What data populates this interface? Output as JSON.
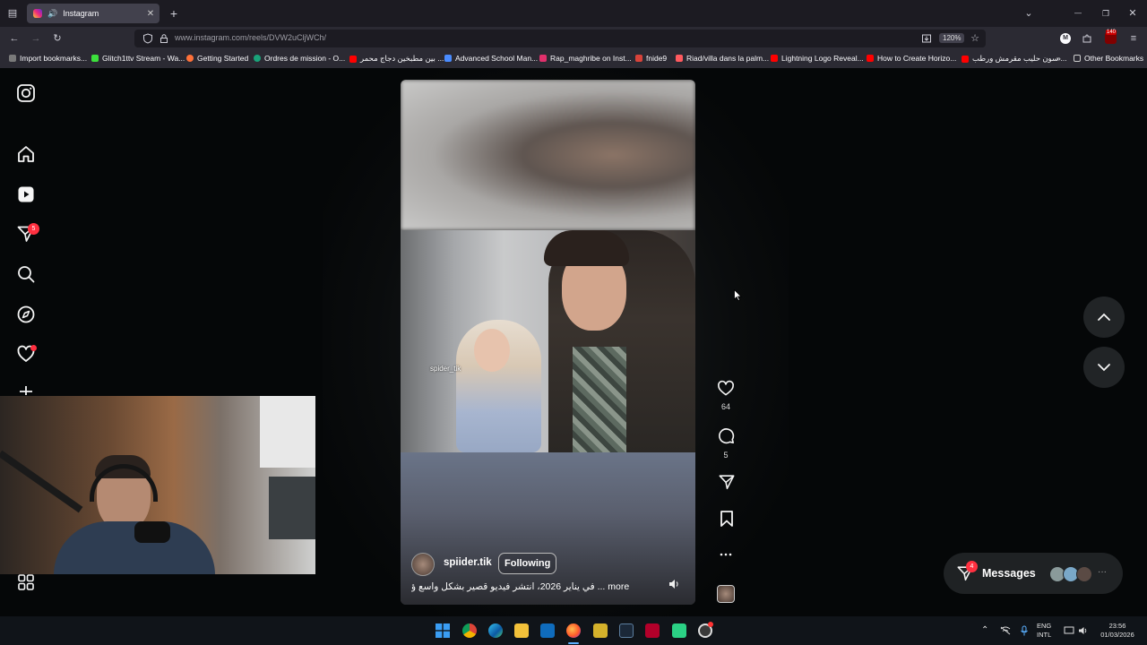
{
  "browser": {
    "tab_title": "Instagram",
    "tab_close": "✕",
    "new_tab": "+",
    "url": "www.instagram.com/reels/DVW2uCljWCh/",
    "zoom": "120%",
    "window_controls": {
      "minimize": "—",
      "maximize": "❐",
      "close": "✕"
    },
    "ext_badge": "140"
  },
  "bookmarks": [
    {
      "label": "Import bookmarks...",
      "color": "#7a7a7a"
    },
    {
      "label": "Glitch1ttv Stream - Wa...",
      "color": "#3ce03c"
    },
    {
      "label": "Getting Started",
      "color": "#ff7139"
    },
    {
      "label": "Ordres de mission - O...",
      "color": "#1aa37a"
    },
    {
      "label": "بين مطبخين دجاج محمر ...",
      "color": "#ff0000"
    },
    {
      "label": "Advanced School Man...",
      "color": "#4a8cff"
    },
    {
      "label": "Rap_maghribe on Inst...",
      "color": "#e1306c"
    },
    {
      "label": "fnide9",
      "color": "#d8433a"
    },
    {
      "label": "Riad/villa dans la palm...",
      "color": "#ff5a5f"
    },
    {
      "label": "Lightning Logo Reveal...",
      "color": "#ff0000"
    },
    {
      "label": "How to Create Horizo...",
      "color": "#ff0000"
    },
    {
      "label": "سون حليب مقرمش ورطب ...",
      "color": "#ff0000"
    }
  ],
  "other_bookmarks": "Other Bookmarks",
  "sidebar": {
    "items": [
      "instagram-logo",
      "home",
      "reels",
      "direct",
      "search",
      "explore",
      "notifications",
      "create",
      "more"
    ],
    "direct_badge": "5"
  },
  "reel": {
    "username": "spiider.tik",
    "follow_label": "Following",
    "caption": "في يناير 2026، انتشر فيديو قصير بشكل واسع ؤ ... more",
    "watermark": "spider_tik"
  },
  "actions": {
    "likes": "64",
    "comments": "5"
  },
  "messages": {
    "label": "Messages",
    "badge": "4",
    "more": "···"
  },
  "taskbar": {
    "lang_top": "ENG",
    "lang_bottom": "INTL",
    "time": "23:56",
    "date": "01/03/2026"
  },
  "colors": {
    "accent_red": "#ff3040",
    "page_bg": "#050708"
  }
}
